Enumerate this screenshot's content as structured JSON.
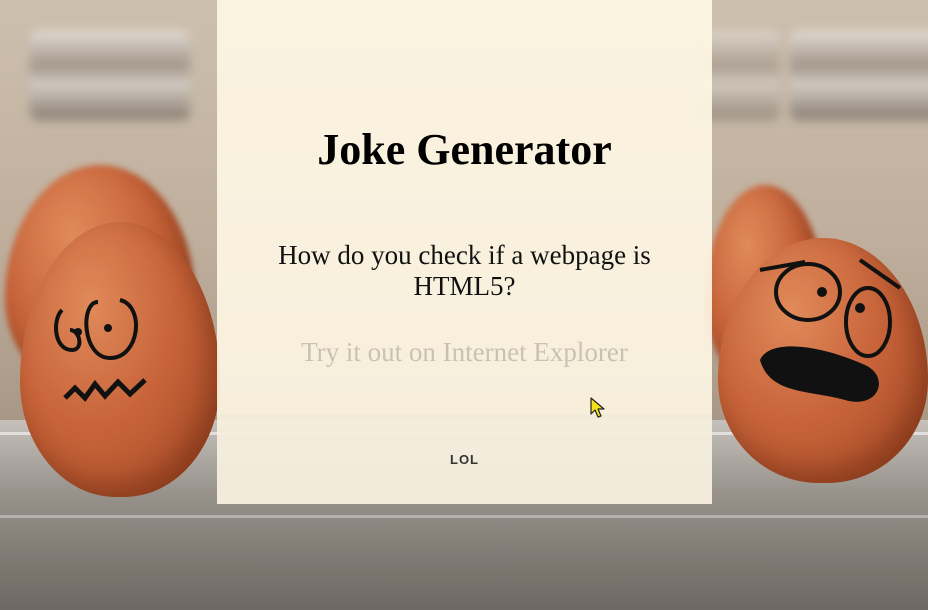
{
  "app": {
    "title": "Joke Generator"
  },
  "joke": {
    "question": "How do you check if a webpage is HTML5?",
    "punchline": "Try it out on Internet Explorer"
  },
  "actions": {
    "lol_label": "LOL"
  },
  "colors": {
    "card_background": "#fff8e6",
    "title_text": "#000000",
    "punchline_text": "#c9c2b4",
    "button_text": "#333333"
  }
}
